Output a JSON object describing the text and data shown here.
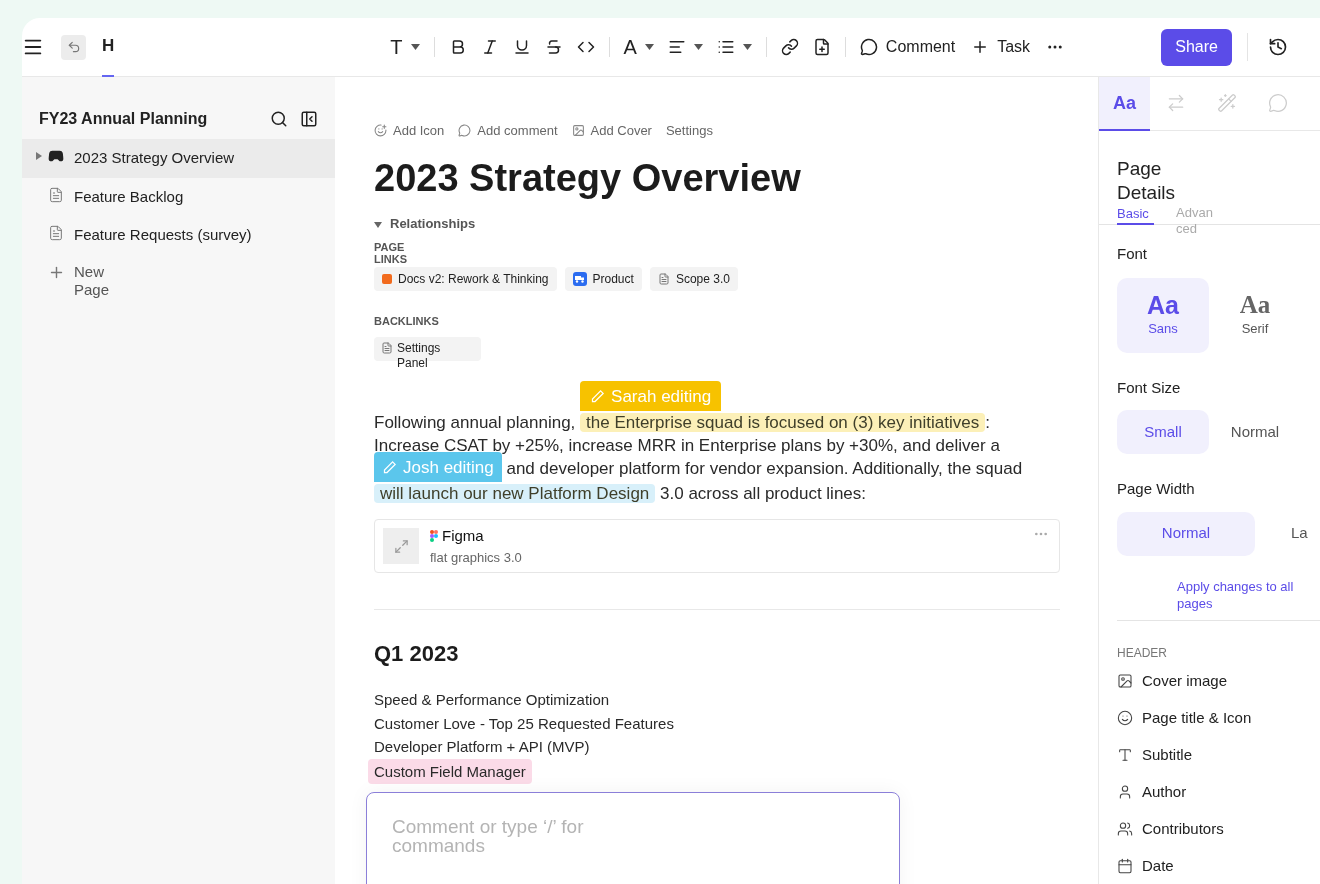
{
  "toolbar": {
    "tab": {
      "label": "H",
      "selected": true
    },
    "format_items": [
      {
        "kind": "text_style",
        "label": "T"
      },
      {
        "kind": "bold"
      },
      {
        "kind": "italic"
      },
      {
        "kind": "underline"
      },
      {
        "kind": "strike"
      },
      {
        "kind": "code"
      },
      {
        "kind": "color",
        "label": "A"
      },
      {
        "kind": "align"
      },
      {
        "kind": "list"
      },
      {
        "kind": "link"
      },
      {
        "kind": "subpage"
      }
    ],
    "comment_label": "Comment",
    "task_label": "Task",
    "share_label": "Share"
  },
  "sidebar": {
    "title": "FY23 Annual Planning",
    "items": [
      {
        "kind": "game",
        "label": "2023 Strategy Overview",
        "selected": true
      },
      {
        "kind": "doc",
        "label": "Feature Backlog",
        "selected": false
      },
      {
        "kind": "doc",
        "label": "Feature Requests (survey)",
        "selected": false
      },
      {
        "kind": "add",
        "label": "New Page",
        "selected": false
      }
    ]
  },
  "document": {
    "actions": [
      {
        "kind": "icon",
        "label": "Add Icon"
      },
      {
        "kind": "comment",
        "label": "Add comment"
      },
      {
        "kind": "cover",
        "label": "Add Cover"
      },
      {
        "kind": "settings",
        "label": "Settings"
      }
    ],
    "title": "2023 Strategy Overview",
    "relationships": {
      "label": "Relationships",
      "expanded": true
    },
    "page_links_label": "PAGE LINKS",
    "page_links": [
      {
        "kind": "square",
        "label": "Docs v2: Rework & Thinking",
        "color": "#f26b1d"
      },
      {
        "kind": "app",
        "label": "Product",
        "color": "#2b6cf0"
      },
      {
        "kind": "doc",
        "label": "Scope 3.0"
      }
    ],
    "backlinks_label": "BACKLINKS",
    "backlinks": [
      {
        "label": "Settings Panel"
      }
    ],
    "paragraph": [
      [
        {
          "kind": "text",
          "text": "Following annual planning, "
        },
        {
          "kind": "highlight",
          "text": "the Enterprise squad is focused on (3) key initiatives",
          "color": "#fcf0b8",
          "editor": {
            "label": "Sarah editing",
            "color": "#f7c200"
          }
        },
        {
          "kind": "text",
          "text": ":"
        }
      ],
      [
        {
          "kind": "text",
          "text": "Increase CSAT by +25%, increase MRR in Enterprise plans by +30%, and deliver a"
        }
      ],
      [
        {
          "kind": "editor_tag",
          "text": "Josh editing",
          "color": "#5bc6ec"
        },
        {
          "kind": "text",
          "text": " and developer platform for vendor expansion. Additionally, the squad"
        }
      ],
      [
        {
          "kind": "highlight",
          "text": "will launch our new Platform Design",
          "color": "#d8f0fa"
        },
        {
          "kind": "text",
          "text": " 3.0 across all product lines:"
        }
      ]
    ],
    "embed": {
      "title": "Figma",
      "subtitle": "flat graphics 3.0"
    },
    "section_heading": "Q1 2023",
    "list": [
      {
        "text": "Speed & Performance Optimization"
      },
      {
        "text": "Customer Love - Top 25 Requested Features"
      },
      {
        "text": "Developer Platform + API (MVP)"
      },
      {
        "text": "Custom Field Manager",
        "color": "#fbdbe8"
      }
    ],
    "comment_box": {
      "placeholder": "Comment or type ‘/’ for commands"
    }
  },
  "panel": {
    "tabs": [
      {
        "kind": "text",
        "label": "Aa",
        "selected": true
      },
      {
        "kind": "relations",
        "selected": false
      },
      {
        "kind": "magic",
        "selected": false
      },
      {
        "kind": "comments",
        "selected": false
      }
    ],
    "title": "Page Details",
    "subtabs": [
      {
        "label": "Basic",
        "selected": true
      },
      {
        "label": "Advanced",
        "selected": false
      }
    ],
    "font_label": "Font",
    "fonts": [
      {
        "kind": "sans",
        "sample": "Aa",
        "label": "Sans",
        "selected": true
      },
      {
        "kind": "serif",
        "sample": "Aa",
        "label": "Serif",
        "selected": false
      }
    ],
    "font_size_label": "Font Size",
    "font_sizes": [
      {
        "label": "Small",
        "selected": true
      },
      {
        "label": "Normal",
        "selected": false
      }
    ],
    "page_width_label": "Page Width",
    "page_widths": [
      {
        "label": "Normal",
        "selected": true
      },
      {
        "label": "La",
        "selected": false
      }
    ],
    "apply_link": "Apply changes to all pages",
    "header_label": "HEADER",
    "header_items": [
      {
        "kind": "cover",
        "label": "Cover image"
      },
      {
        "kind": "title",
        "label": "Page title & Icon"
      },
      {
        "kind": "subtitle",
        "label": "Subtitle"
      },
      {
        "kind": "author",
        "label": "Author"
      },
      {
        "kind": "contributors",
        "label": "Contributors"
      },
      {
        "kind": "date",
        "label": "Date"
      }
    ]
  }
}
